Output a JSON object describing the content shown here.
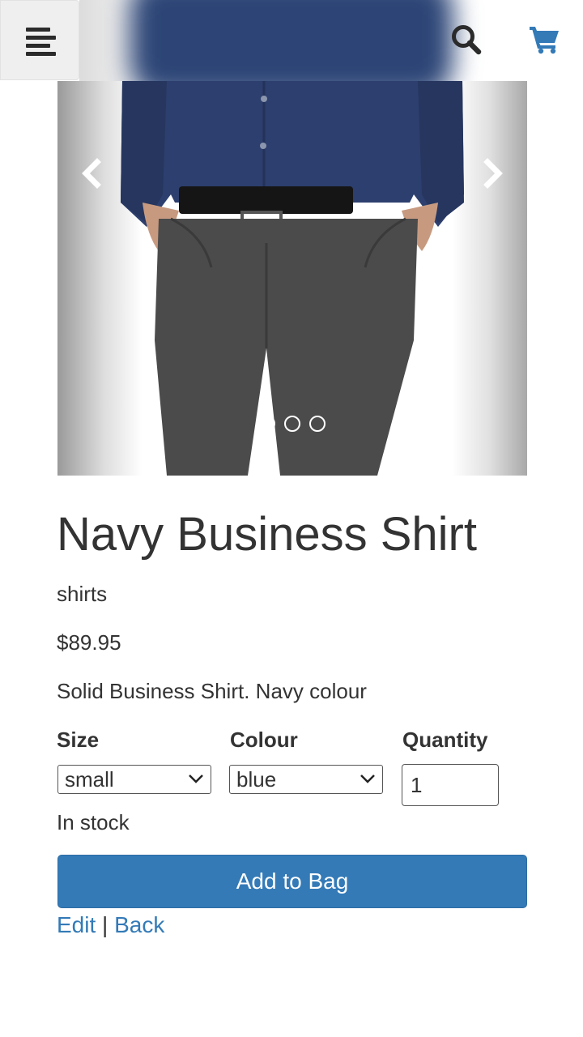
{
  "header": {
    "menu_icon": "menu-lines-icon",
    "search_icon": "search-icon",
    "cart_icon": "cart-icon",
    "accent_color": "#337ab7"
  },
  "carousel": {
    "image_alt": "Model wearing navy business shirt and grey trousers",
    "slide_count": 3,
    "active_slide": 1,
    "prev_icon": "chevron-left-icon",
    "next_icon": "chevron-right-icon"
  },
  "product": {
    "title": "Navy Business Shirt",
    "category": "shirts",
    "price": "$89.95",
    "description": "Solid Business Shirt. Navy colour",
    "size_label": "Size",
    "size_value": "small",
    "colour_label": "Colour",
    "colour_value": "blue",
    "quantity_label": "Quantity",
    "quantity_value": "1",
    "stock_status": "In stock",
    "add_button": "Add to Bag",
    "edit_link": "Edit",
    "separator": "|",
    "back_link": "Back"
  }
}
